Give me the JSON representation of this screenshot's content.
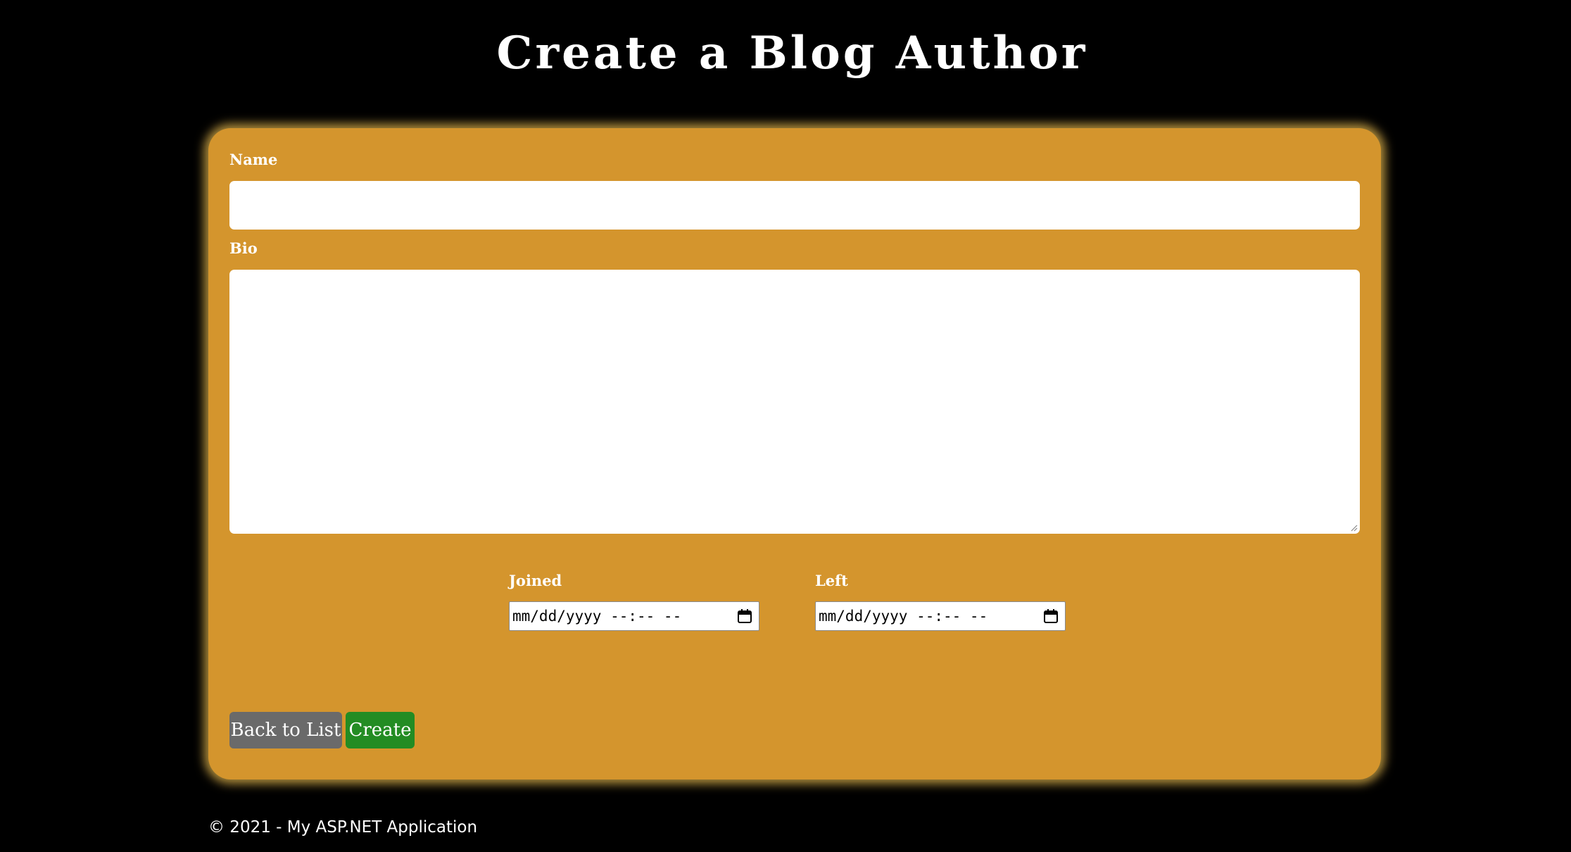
{
  "page": {
    "title": "Create a Blog Author"
  },
  "form": {
    "name": {
      "label": "Name",
      "value": ""
    },
    "bio": {
      "label": "Bio",
      "value": ""
    },
    "joined": {
      "label": "Joined",
      "placeholder": "mm/dd/yyyy --:-- --"
    },
    "left": {
      "label": "Left",
      "placeholder": "mm/dd/yyyy --:-- --"
    },
    "buttons": {
      "back_label": "Back to List",
      "create_label": "Create"
    }
  },
  "footer": {
    "text": "© 2021 - My ASP.NET Application"
  },
  "colors": {
    "background": "#000000",
    "card": "#d4952d",
    "back_button": "#6a6a6a",
    "create_button": "#238c23"
  },
  "icons": {
    "date_picker": "calendar-icon"
  }
}
